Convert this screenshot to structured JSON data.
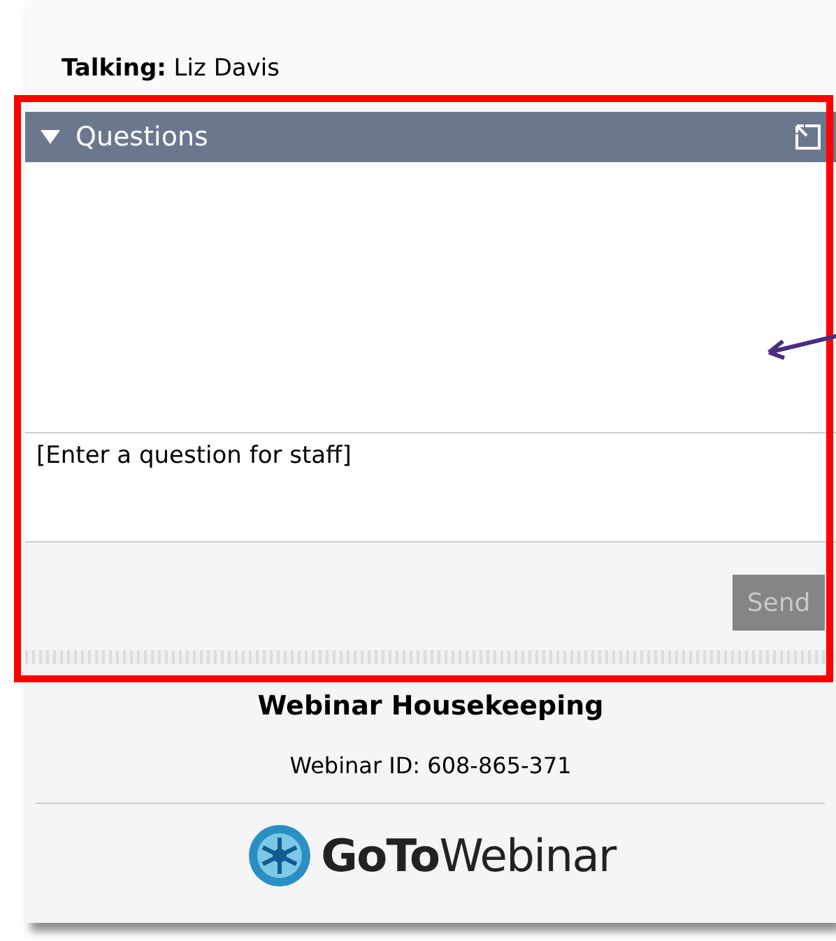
{
  "talking": "**Talking:** Liz Davis",
  "questions_panel": {
    "title": "Questions",
    "expanded": true,
    "input": {
      "placeholder": "[Enter a question for staff]"
    },
    "send_button": {
      "label": "Send",
      "disabled": true
    }
  },
  "footer": {
    "title": "Webinar Housekeeping",
    "webinar_id": "Webinar ID: 608-865-371",
    "logo": "**GoTo**Webinar"
  }
}
